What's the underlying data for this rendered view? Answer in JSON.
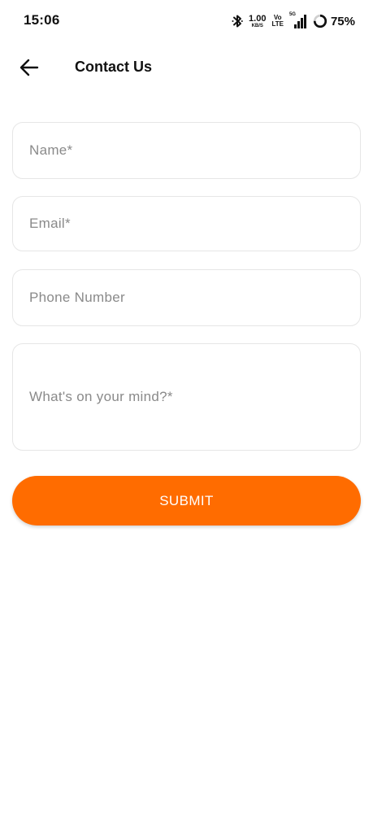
{
  "status_bar": {
    "time": "15:06",
    "net_speed_value": "1.00",
    "net_speed_unit": "KB/S",
    "volte_top": "Vo",
    "volte_bottom": "LTE",
    "network_type": "5G",
    "battery_percent": "75%",
    "battery_level": 0.75,
    "icons": [
      "bluetooth-icon",
      "signal-icon",
      "battery-icon"
    ]
  },
  "header": {
    "title": "Contact Us",
    "back_icon": "arrow-left-icon"
  },
  "form": {
    "name_placeholder": "Name*",
    "email_placeholder": "Email*",
    "phone_placeholder": "Phone Number",
    "message_placeholder": "What's on your mind?*",
    "submit_label": "SUBMIT"
  },
  "colors": {
    "accent": "#ff6c00",
    "field_border": "#e6e6e6",
    "placeholder": "#8a8a8a"
  }
}
